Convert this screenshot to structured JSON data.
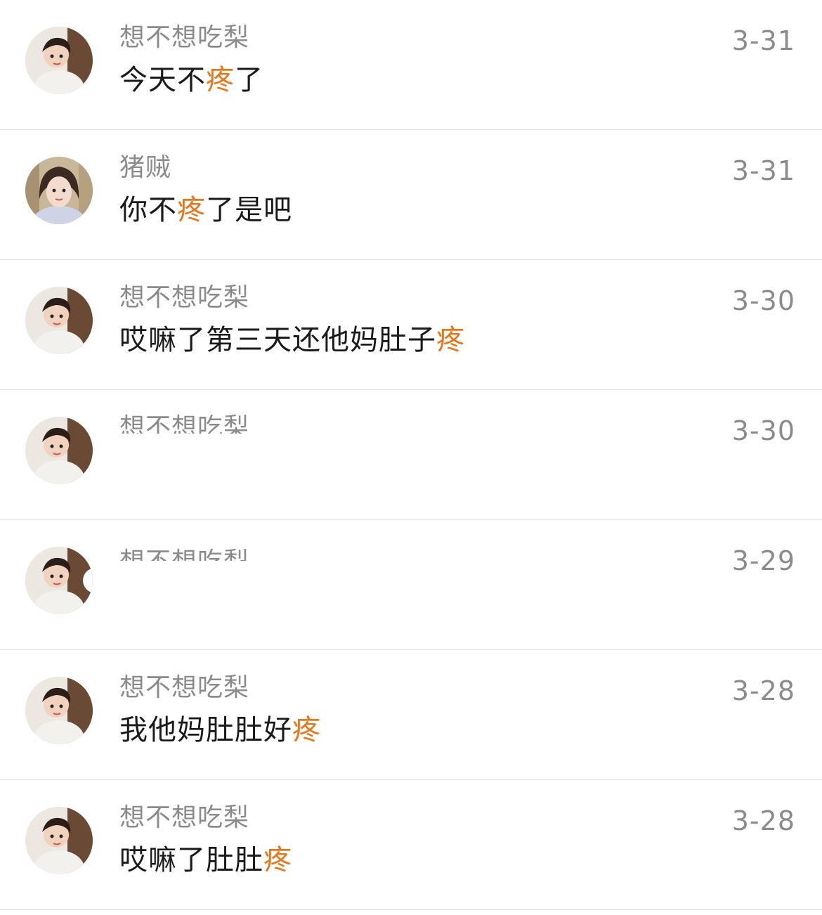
{
  "highlight_color": "#e8761a",
  "comments": [
    {
      "name": "想不想吃梨",
      "date": "3-31",
      "message_parts": [
        "今天不",
        "疼",
        "了"
      ],
      "avatar": "girl-avatar"
    },
    {
      "name": "猪贼",
      "date": "3-31",
      "message_parts": [
        "你不",
        "疼",
        "了是吧"
      ],
      "avatar": "girl-portrait-avatar"
    },
    {
      "name": "想不想吃梨",
      "date": "3-30",
      "message_parts": [
        "哎嘛了第三天还他妈肚子",
        "疼",
        ""
      ],
      "avatar": "girl-avatar"
    },
    {
      "name": "想不想吃梨",
      "date": "3-30",
      "message_parts": [
        "",
        "",
        ""
      ],
      "avatar": "girl-avatar"
    },
    {
      "name": "想不想吃梨",
      "date": "3-29",
      "message_parts": [
        "",
        "",
        ""
      ],
      "avatar": "girl-avatar"
    },
    {
      "name": "想不想吃梨",
      "date": "3-28",
      "message_parts": [
        "我他妈肚肚好",
        "疼",
        ""
      ],
      "avatar": "girl-avatar"
    },
    {
      "name": "想不想吃梨",
      "date": "3-28",
      "message_parts": [
        "哎嘛了肚肚",
        "疼",
        ""
      ],
      "avatar": "girl-avatar"
    }
  ]
}
